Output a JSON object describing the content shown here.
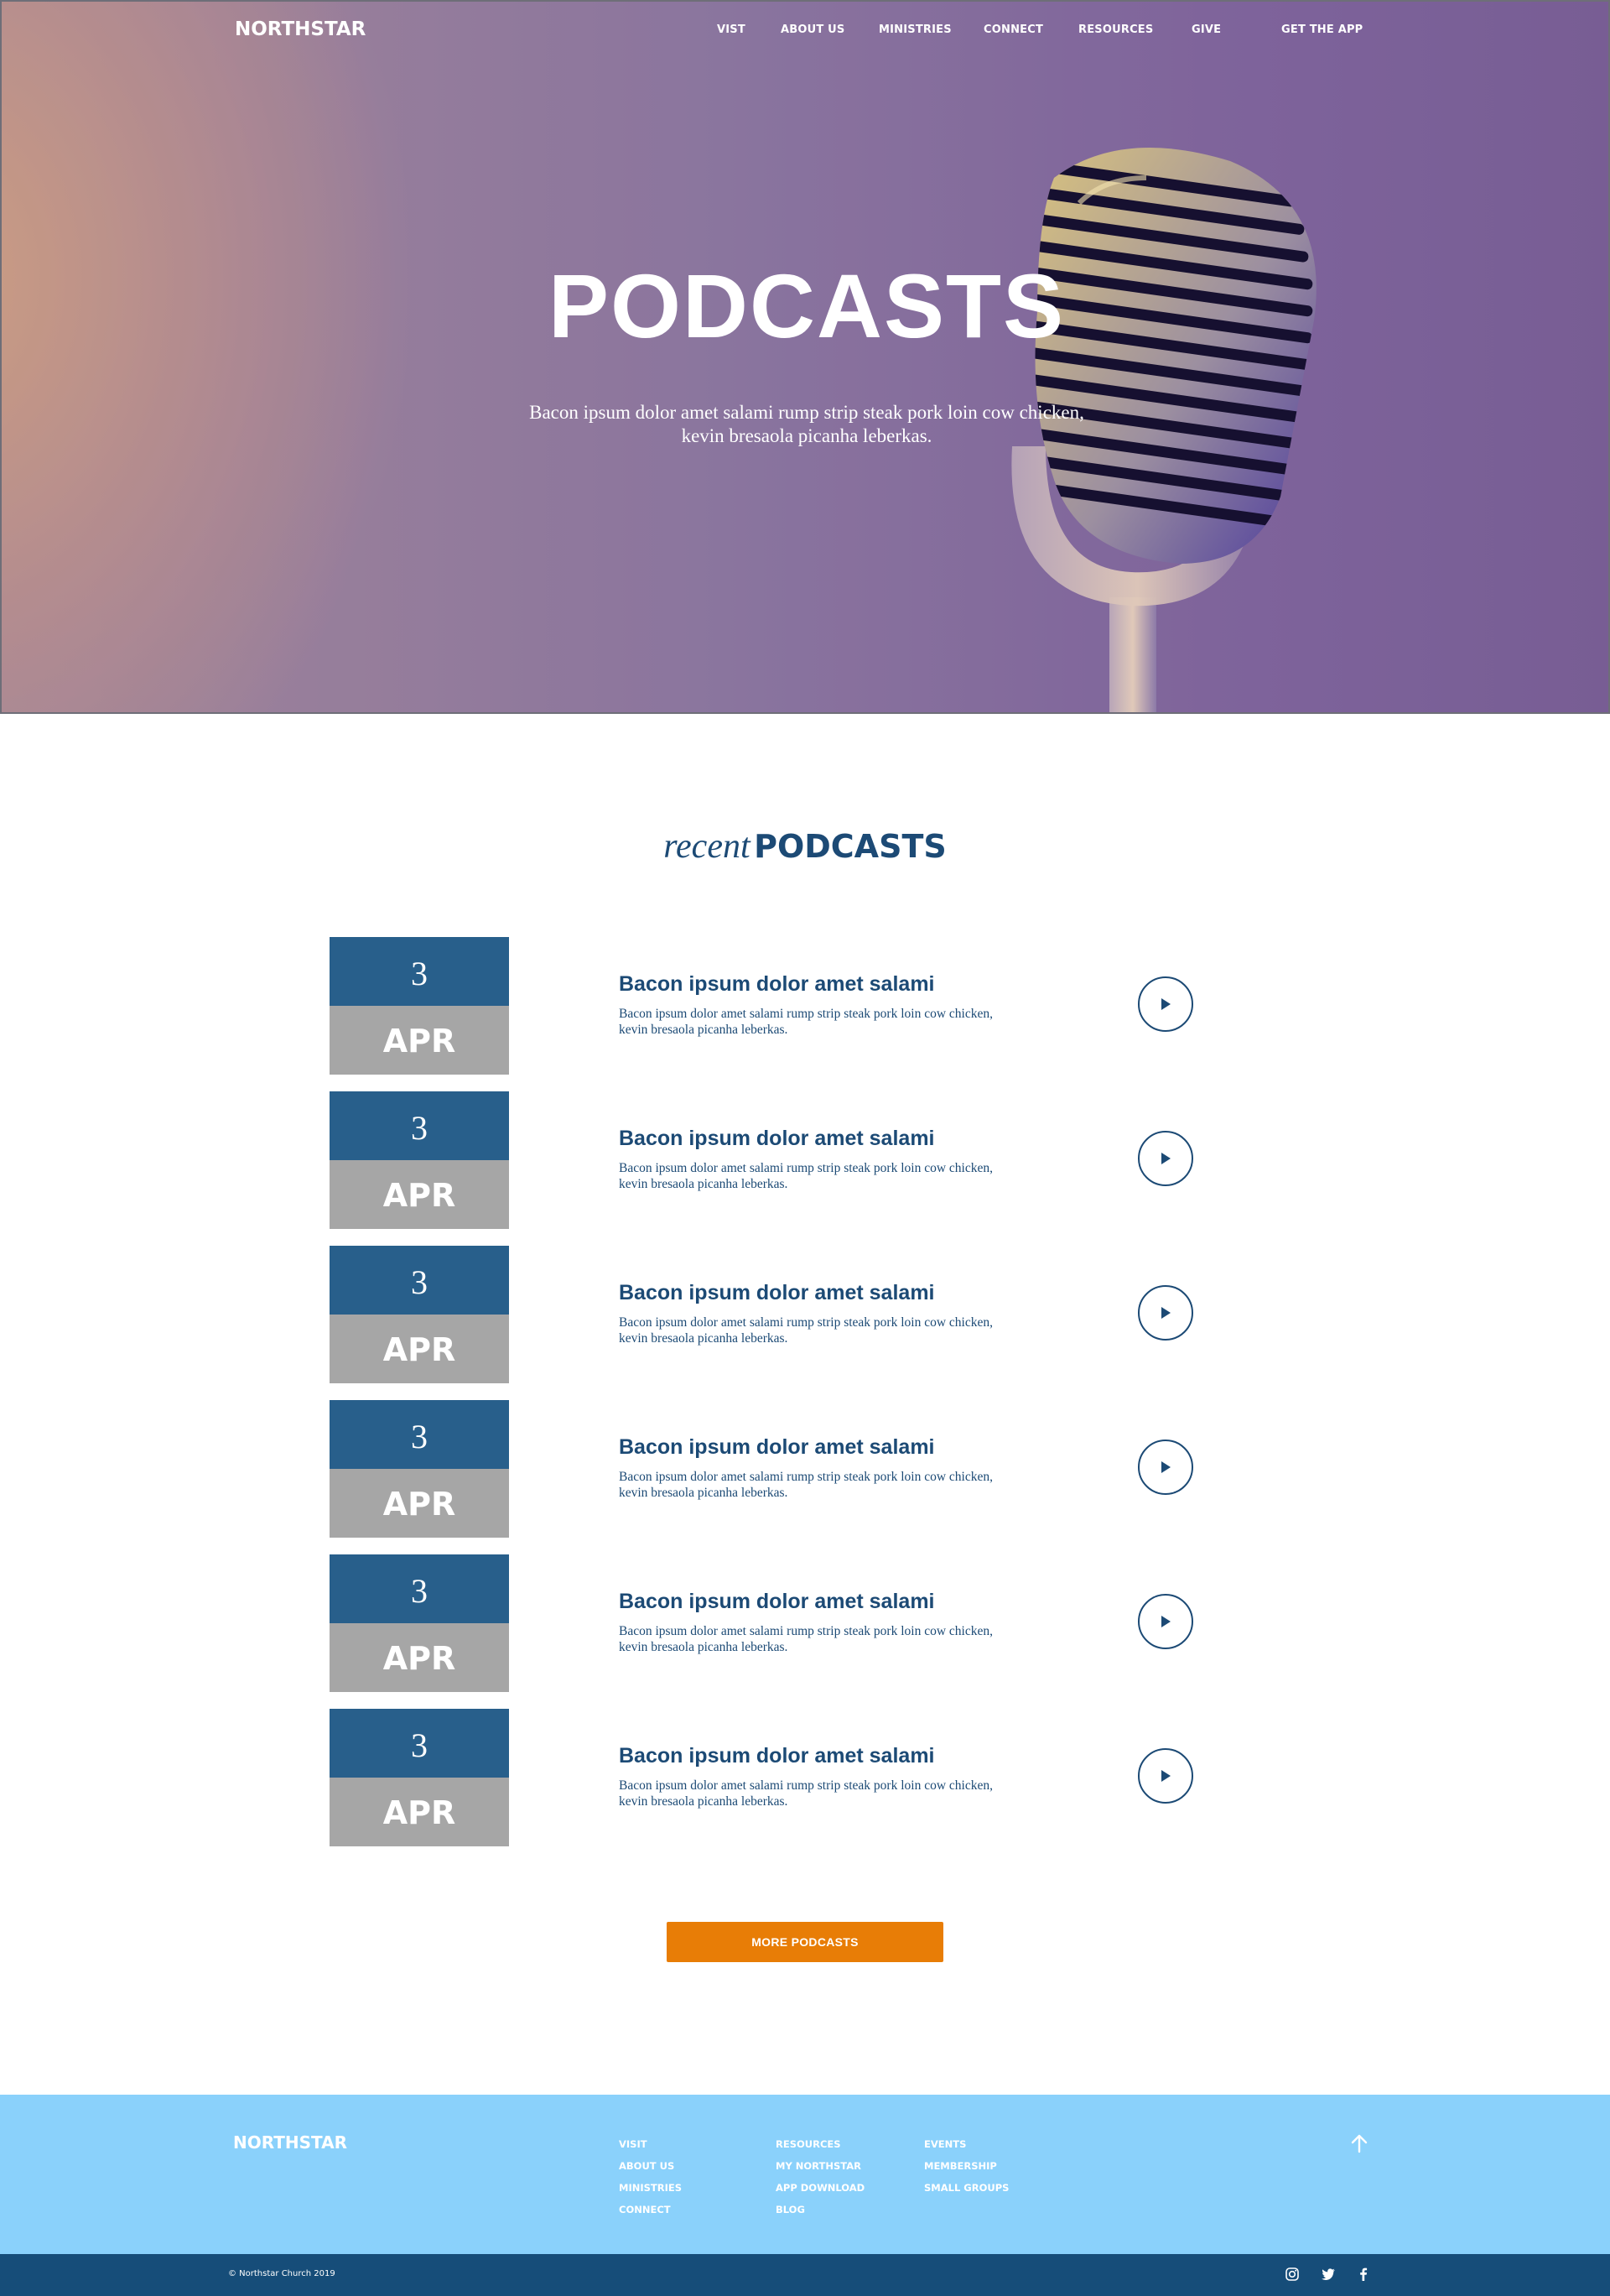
{
  "brand": "NORTHSTAR",
  "nav": {
    "items": [
      "VIST",
      "ABOUT US",
      "MINISTRIES",
      "CONNECT",
      "RESOURCES",
      "GIVE"
    ],
    "cta": "GET THE APP"
  },
  "hero": {
    "title": "PODCASTS",
    "subtitle": "Bacon ipsum dolor amet salami rump strip steak pork loin cow chicken, kevin bresaola picanha leberkas.",
    "image_icon": "microphone-image"
  },
  "recent": {
    "title_lead": "recent",
    "title_main": "PODCASTS"
  },
  "podcasts": [
    {
      "day": "3",
      "month": "APR",
      "title": "Bacon ipsum dolor amet salami",
      "description": "Bacon ipsum dolor amet salami rump strip steak pork loin cow chicken, kevin bresaola picanha leberkas."
    },
    {
      "day": "3",
      "month": "APR",
      "title": "Bacon ipsum dolor amet salami",
      "description": "Bacon ipsum dolor amet salami rump strip steak pork loin cow chicken, kevin bresaola picanha leberkas."
    },
    {
      "day": "3",
      "month": "APR",
      "title": "Bacon ipsum dolor amet salami",
      "description": "Bacon ipsum dolor amet salami rump strip steak pork loin cow chicken, kevin bresaola picanha leberkas."
    },
    {
      "day": "3",
      "month": "APR",
      "title": "Bacon ipsum dolor amet salami",
      "description": "Bacon ipsum dolor amet salami rump strip steak pork loin cow chicken, kevin bresaola picanha leberkas."
    },
    {
      "day": "3",
      "month": "APR",
      "title": "Bacon ipsum dolor amet salami",
      "description": "Bacon ipsum dolor amet salami rump strip steak pork loin cow chicken, kevin bresaola picanha leberkas."
    },
    {
      "day": "3",
      "month": "APR",
      "title": "Bacon ipsum dolor amet salami",
      "description": "Bacon ipsum dolor amet salami rump strip steak pork loin cow chicken, kevin bresaola picanha leberkas."
    }
  ],
  "more_button": "MORE PODCASTS",
  "footer": {
    "logo": "NORTHSTAR",
    "col1": [
      "VISIT",
      "ABOUT US",
      "MINISTRIES",
      "CONNECT"
    ],
    "col2": [
      "RESOURCES",
      "MY NORTHSTAR",
      "APP DOWNLOAD",
      "BLOG"
    ],
    "col3": [
      "EVENTS",
      "MEMBERSHIP",
      "SMALL GROUPS"
    ],
    "copyright": "© Northstar Church 2019",
    "social_icons": [
      "instagram-icon",
      "twitter-icon",
      "facebook-icon"
    ]
  },
  "colors": {
    "primary_blue": "#1c4a75",
    "date_blue": "#285f8b",
    "date_gray": "#a6a6a6",
    "accent_orange": "#e87d06",
    "footer_light": "#8ad1fb",
    "footer_dark": "#164d79"
  }
}
